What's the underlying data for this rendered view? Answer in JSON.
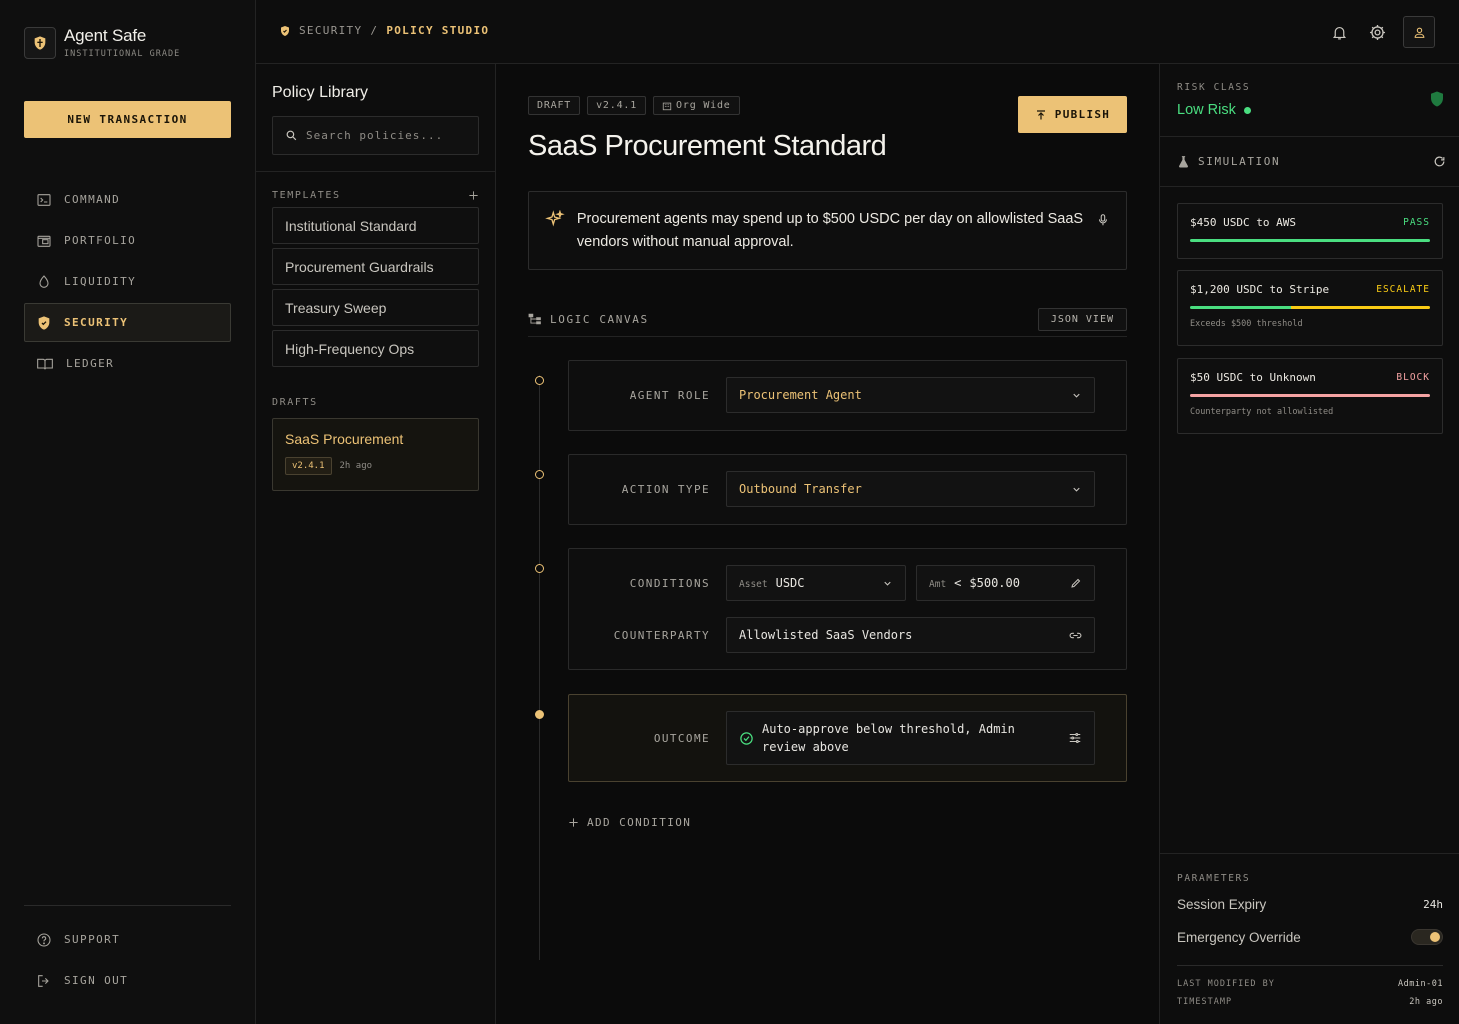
{
  "colors": {
    "accent": "#ecc276",
    "pass": "#4ade80",
    "escalate": "#facc15",
    "block": "#f5a3a3",
    "background": "#0b0b0b"
  },
  "brand": {
    "title": "Agent Safe",
    "subtitle": "INSTITUTIONAL GRADE",
    "logo_icon": "shield-icon"
  },
  "sidebar": {
    "new_transaction": "NEW TRANSACTION",
    "items": [
      {
        "label": "COMMAND",
        "icon": "terminal-icon"
      },
      {
        "label": "PORTFOLIO",
        "icon": "wallet-icon"
      },
      {
        "label": "LIQUIDITY",
        "icon": "droplet-icon"
      },
      {
        "label": "SECURITY",
        "icon": "shield-icon",
        "active": true
      },
      {
        "label": "LEDGER",
        "icon": "book-icon"
      }
    ],
    "bottom": [
      {
        "label": "SUPPORT",
        "icon": "help-circle-icon"
      },
      {
        "label": "SIGN OUT",
        "icon": "logout-icon"
      }
    ]
  },
  "topbar": {
    "breadcrumb": {
      "section": "SECURITY",
      "separator": "/",
      "current": "POLICY STUDIO"
    }
  },
  "library": {
    "title": "Policy Library",
    "search_placeholder": "Search policies...",
    "templates_label": "TEMPLATES",
    "templates": [
      "Institutional Standard",
      "Procurement Guardrails",
      "Treasury Sweep",
      "High-Frequency Ops"
    ],
    "drafts_label": "DRAFTS",
    "drafts": [
      {
        "title": "SaaS Procurement",
        "version": "v2.4.1",
        "time": "2h ago"
      }
    ]
  },
  "editor": {
    "badges": {
      "status": "DRAFT",
      "version": "v2.4.1",
      "scope": "Org Wide"
    },
    "title": "SaaS Procurement Standard",
    "publish": "PUBLISH",
    "prompt": "Procurement agents may spend up to $500 USDC per day on allowlisted SaaS vendors without manual approval.",
    "canvas_title": "LOGIC CANVAS",
    "json_view": "JSON VIEW",
    "agent_role": {
      "label": "AGENT ROLE",
      "value": "Procurement Agent"
    },
    "action_type": {
      "label": "ACTION TYPE",
      "value": "Outbound Transfer"
    },
    "conditions": {
      "label": "CONDITIONS",
      "asset_key": "Asset",
      "asset_value": "USDC",
      "amt_key": "Amt",
      "amt_op": "<",
      "amt_value": "$500.00"
    },
    "counterparty": {
      "label": "COUNTERPARTY",
      "value": "Allowlisted SaaS Vendors"
    },
    "outcome": {
      "label": "OUTCOME",
      "value": "Auto-approve below threshold, Admin review above"
    },
    "add_condition": "ADD CONDITION"
  },
  "risk": {
    "label": "RISK CLASS",
    "value": "Low Risk"
  },
  "simulation": {
    "title": "SIMULATION",
    "cases": [
      {
        "name": "$450 USDC to AWS",
        "status": "PASS",
        "note": ""
      },
      {
        "name": "$1,200 USDC to Stripe",
        "status": "ESCALATE",
        "note": "Exceeds $500 threshold"
      },
      {
        "name": "$50 USDC to Unknown",
        "status": "BLOCK",
        "note": "Counterparty not allowlisted"
      }
    ]
  },
  "parameters": {
    "label": "PARAMETERS",
    "session_expiry": {
      "label": "Session Expiry",
      "value": "24h"
    },
    "emergency_override": {
      "label": "Emergency Override",
      "enabled": true
    },
    "last_modified_label": "LAST MODIFIED BY",
    "last_modified_value": "Admin-01",
    "timestamp_label": "TIMESTAMP",
    "timestamp_value": "2h ago"
  }
}
